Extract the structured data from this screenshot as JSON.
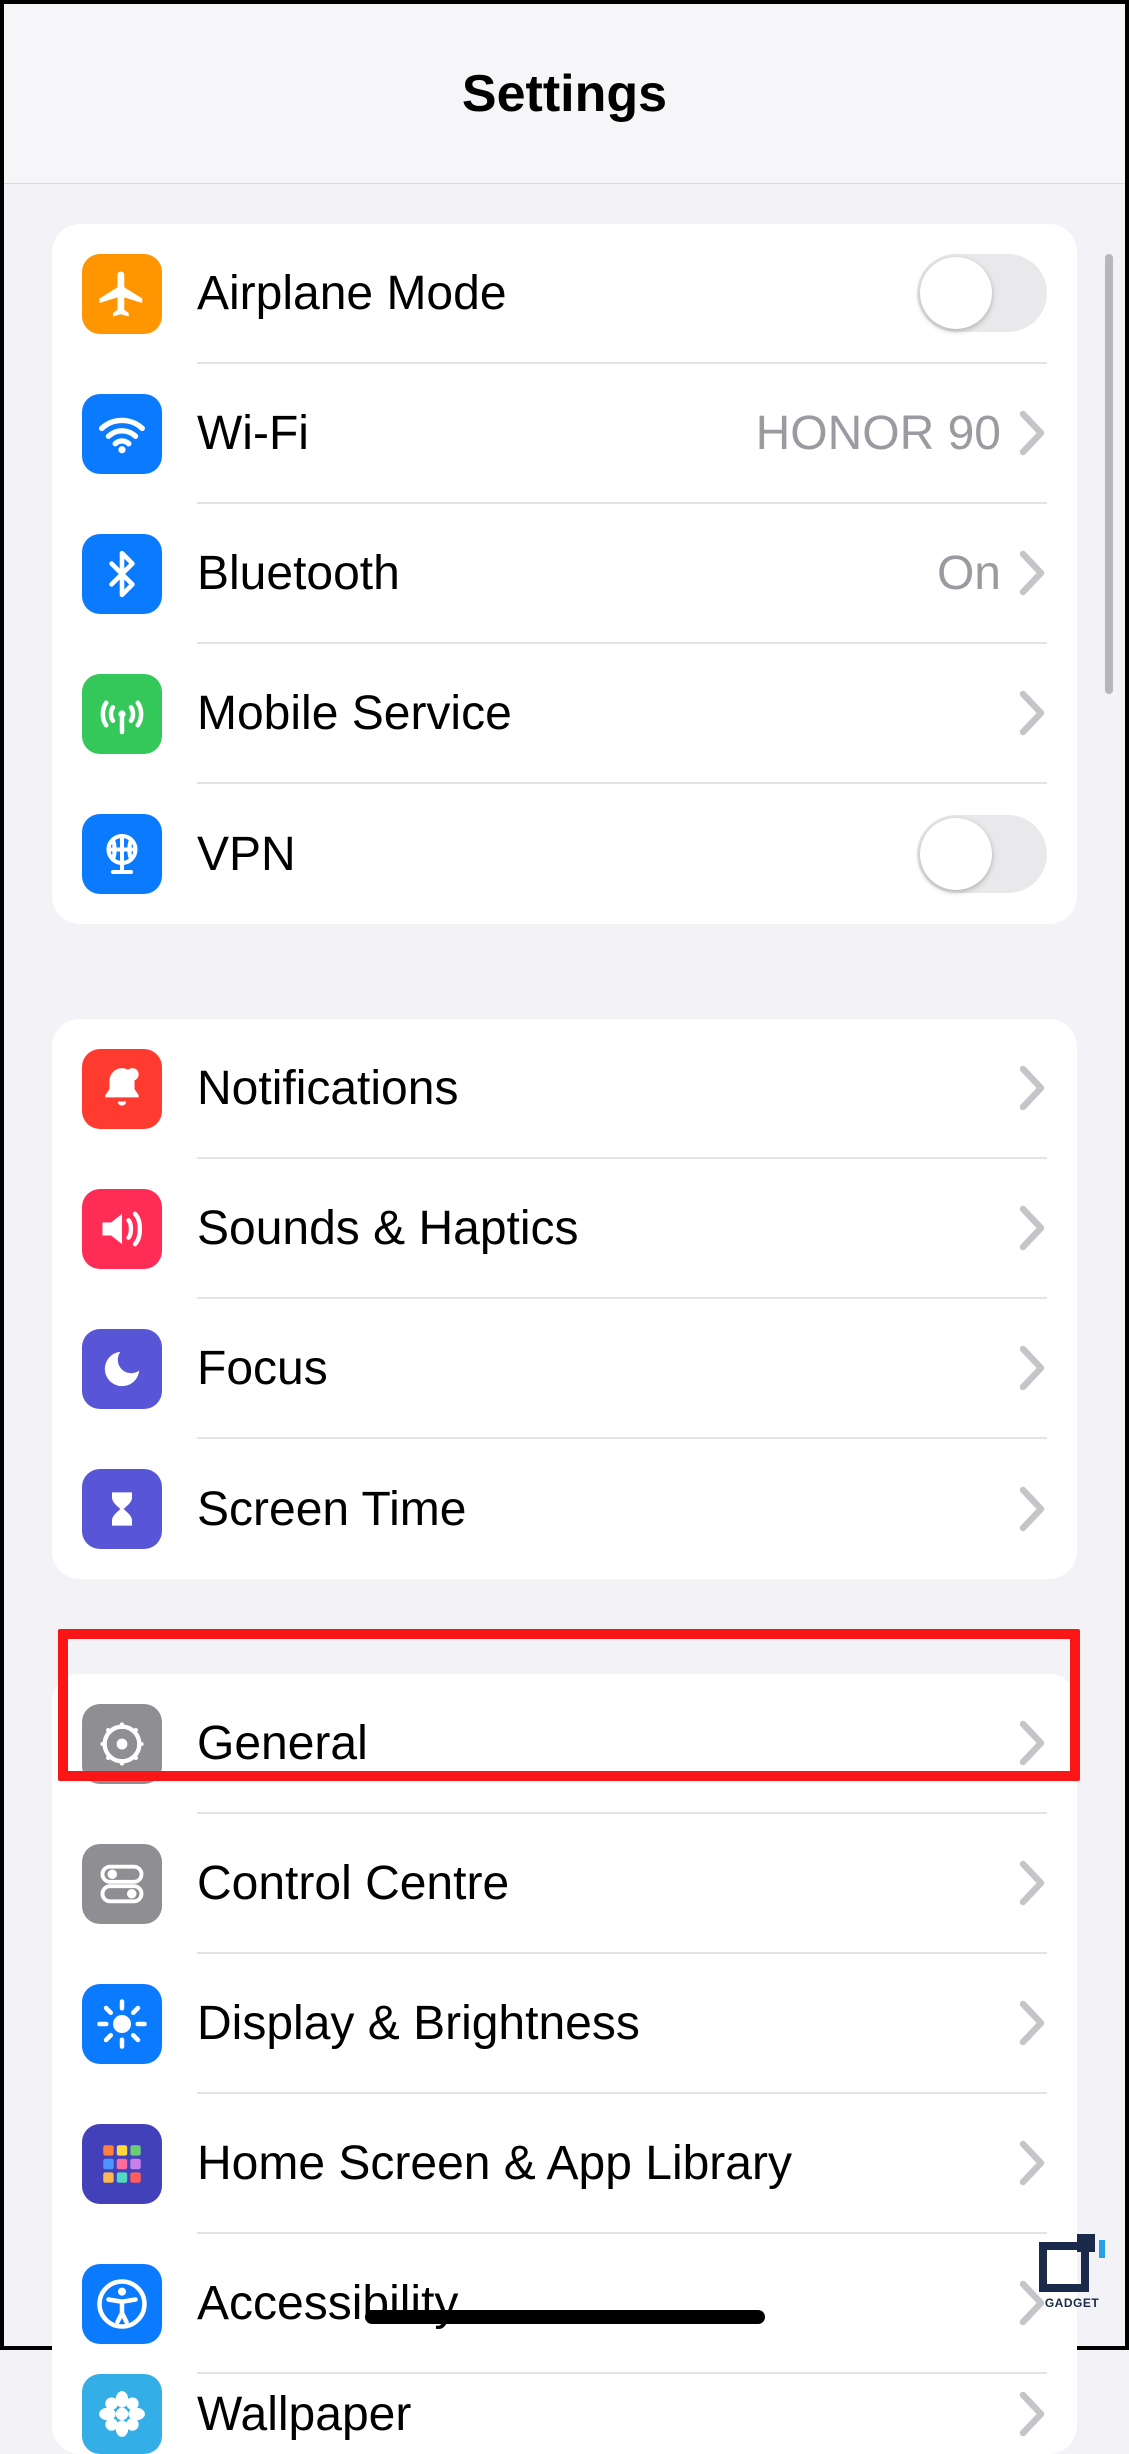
{
  "header": {
    "title": "Settings"
  },
  "groups": [
    {
      "rows": [
        {
          "id": "airplane",
          "icon": "airplane-icon",
          "icon_bg": "#ff9500",
          "label": "Airplane Mode",
          "control": "toggle",
          "toggle_on": false
        },
        {
          "id": "wifi",
          "icon": "wifi-icon",
          "icon_bg": "#0a7aff",
          "label": "Wi-Fi",
          "value": "HONOR 90",
          "control": "disclosure"
        },
        {
          "id": "bluetooth",
          "icon": "bluetooth-icon",
          "icon_bg": "#0a7aff",
          "label": "Bluetooth",
          "value": "On",
          "control": "disclosure"
        },
        {
          "id": "mobile",
          "icon": "antenna-icon",
          "icon_bg": "#34c85a",
          "label": "Mobile Service",
          "control": "disclosure"
        },
        {
          "id": "vpn",
          "icon": "globe-stand-icon",
          "icon_bg": "#0a7aff",
          "label": "VPN",
          "control": "toggle",
          "toggle_on": false
        }
      ]
    },
    {
      "rows": [
        {
          "id": "notifications",
          "icon": "bell-icon",
          "icon_bg": "#ff3b30",
          "label": "Notifications",
          "control": "disclosure"
        },
        {
          "id": "sounds",
          "icon": "speaker-icon",
          "icon_bg": "#ff2d55",
          "label": "Sounds & Haptics",
          "control": "disclosure"
        },
        {
          "id": "focus",
          "icon": "moon-icon",
          "icon_bg": "#5856d6",
          "label": "Focus",
          "control": "disclosure"
        },
        {
          "id": "screentime",
          "icon": "hourglass-icon",
          "icon_bg": "#5856d6",
          "label": "Screen Time",
          "control": "disclosure"
        }
      ]
    },
    {
      "rows": [
        {
          "id": "general",
          "icon": "gear-icon",
          "icon_bg": "#8e8e93",
          "label": "General",
          "control": "disclosure",
          "highlighted": true
        },
        {
          "id": "controlcentre",
          "icon": "switches-icon",
          "icon_bg": "#8e8e93",
          "label": "Control Centre",
          "control": "disclosure"
        },
        {
          "id": "display",
          "icon": "sun-icon",
          "icon_bg": "#0a7aff",
          "label": "Display & Brightness",
          "control": "disclosure"
        },
        {
          "id": "homescreen",
          "icon": "app-grid-icon",
          "icon_bg": "#4341b9",
          "label": "Home Screen & App Library",
          "control": "disclosure"
        },
        {
          "id": "accessibility",
          "icon": "accessibility-icon",
          "icon_bg": "#0a7aff",
          "label": "Accessibility",
          "control": "disclosure"
        },
        {
          "id": "wallpaper",
          "icon": "flower-icon",
          "icon_bg": "#33aee6",
          "label": "Wallpaper",
          "control": "disclosure"
        }
      ]
    }
  ],
  "watermark": {
    "text": "GADGET"
  },
  "highlight": {
    "row_id": "general"
  }
}
